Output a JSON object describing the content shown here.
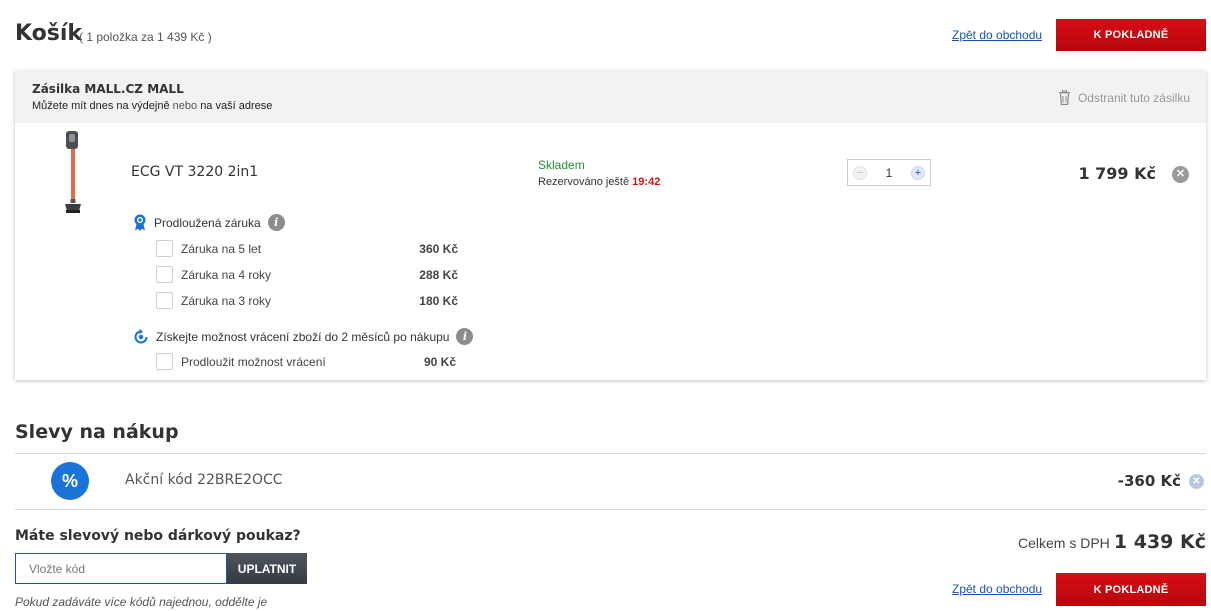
{
  "header": {
    "title": "Košík",
    "summary": "( 1 položka za 1 439 Kč )",
    "back_link": "Zpět do obchodu",
    "checkout_label": "K POKLADNĚ"
  },
  "shipment": {
    "title": "Zásilka MALL.CZ MALL",
    "sub_part1": "Můžete mít dnes na výdejně",
    "sub_part2": "nebo",
    "sub_part3": "na vaší adrese",
    "remove_label": "Odstranit tuto zásilku",
    "item": {
      "name": "ECG VT 3220 2in1",
      "stock": "Skladem",
      "reserved_label": "Rezervováno ještě",
      "reserved_time": "19:42",
      "quantity": "1",
      "price": "1 799 Kč"
    },
    "warranty": {
      "label": "Prodloužená záruka",
      "options": [
        {
          "label": "Záruka na 5 let",
          "price": "360 Kč"
        },
        {
          "label": "Záruka na 4 roky",
          "price": "288 Kč"
        },
        {
          "label": "Záruka na 3 roky",
          "price": "180 Kč"
        }
      ]
    },
    "returns": {
      "label": "Získejte možnost vrácení zboží do 2 měsíců po nákupu",
      "option_label": "Prodloužit možnost vrácení",
      "option_price": "90 Kč"
    }
  },
  "discounts": {
    "title": "Slevy na nákup",
    "icon_symbol": "%",
    "code_label": "Akční kód 22BRE2OCC",
    "value": "-360 Kč"
  },
  "voucher": {
    "question": "Máte slevový nebo dárkový poukaz?",
    "placeholder": "Vložte kód",
    "apply_label": "UPLATNIT",
    "hint": "Pokud zadáváte více kódů najednou, oddělte je"
  },
  "footer": {
    "total_label": "Celkem s DPH",
    "total_value": "1 439 Kč",
    "back_link": "Zpět do obchodu",
    "checkout_label": "K POKLADNĚ"
  }
}
